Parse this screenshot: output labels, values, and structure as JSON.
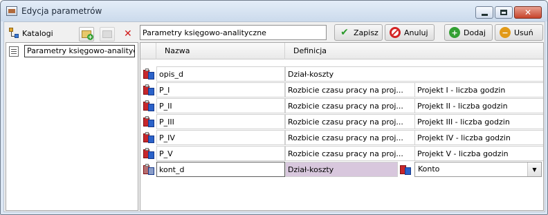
{
  "window": {
    "title": "Edycja parametrów"
  },
  "left_panel": {
    "catalog_label": "Katalogi",
    "tree_items": [
      {
        "label": "Parametry księgowo-analityczne"
      }
    ]
  },
  "toolbar": {
    "name_value": "Parametry księgowo-analityczne",
    "save_label": "Zapisz",
    "cancel_label": "Anuluj",
    "add_label": "Dodaj",
    "remove_label": "Usuń"
  },
  "grid": {
    "headers": {
      "name": "Nazwa",
      "definition": "Definicja"
    },
    "rows": [
      {
        "name": "opis_d",
        "definition": "Dział-koszty",
        "extra": ""
      },
      {
        "name": "P_I",
        "definition": "Rozbicie czasu pracy na proj...",
        "extra": "Projekt I - liczba godzin"
      },
      {
        "name": "P_II",
        "definition": "Rozbicie czasu pracy na proj...",
        "extra": "Projekt II - liczba godzin"
      },
      {
        "name": "P_III",
        "definition": "Rozbicie czasu pracy na proj...",
        "extra": "Projekt III - liczba godzin"
      },
      {
        "name": "P_IV",
        "definition": "Rozbicie czasu pracy na proj...",
        "extra": "Projekt IV - liczba godzin"
      },
      {
        "name": "P_V",
        "definition": "Rozbicie czasu pracy na proj...",
        "extra": "Projekt V - liczba godzin"
      },
      {
        "name": "kont_d",
        "definition": "Dział-koszty",
        "extra": "Konto"
      }
    ]
  },
  "colors": {
    "selected_cell": "#d8c7dd",
    "titlebar": "#dce7f4",
    "close_button": "#c7432b"
  }
}
